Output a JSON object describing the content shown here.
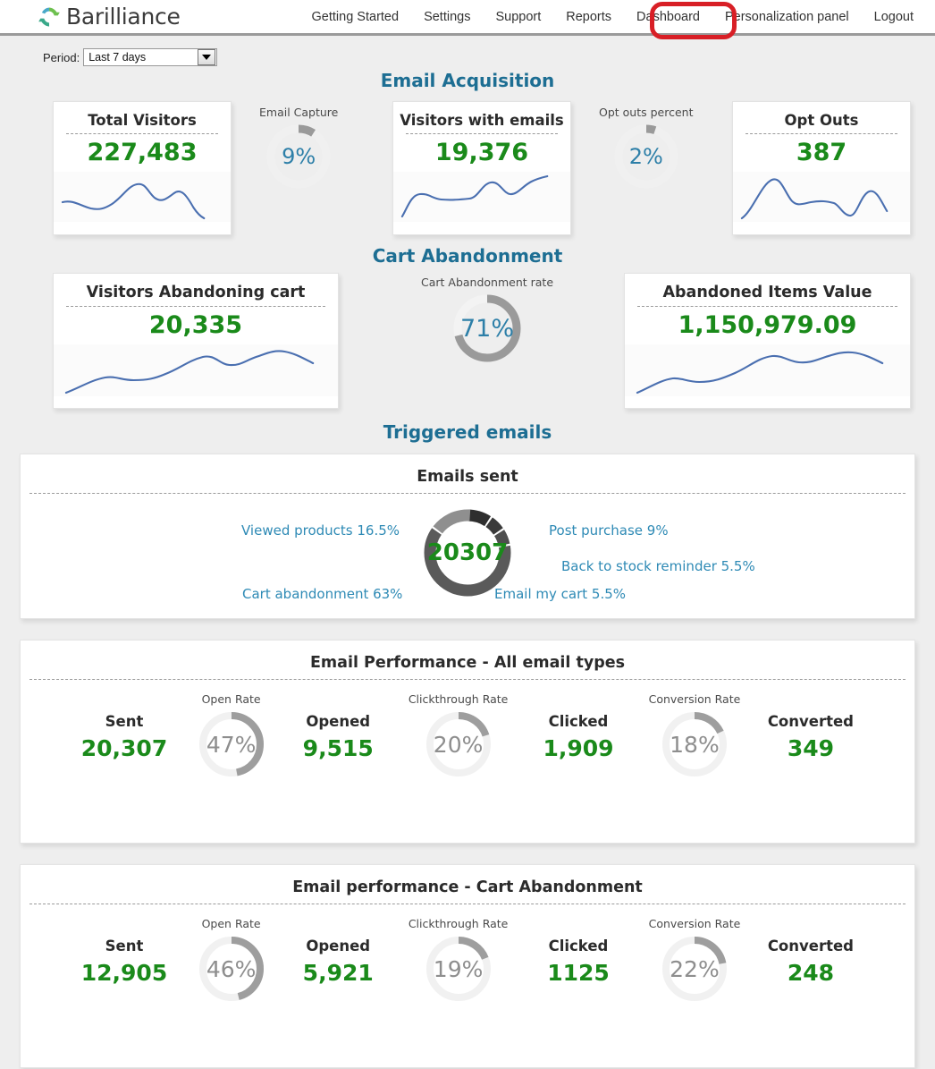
{
  "brand": {
    "name": "Barilliance",
    "logo_icon": "circular-arrow-logo"
  },
  "nav": {
    "items": [
      {
        "label": "Getting Started"
      },
      {
        "label": "Settings"
      },
      {
        "label": "Support"
      },
      {
        "label": "Reports"
      },
      {
        "label": "Dashboard",
        "highlighted": true
      },
      {
        "label": "Personalization panel"
      },
      {
        "label": "Logout"
      }
    ],
    "annotation_color": "#d81f26"
  },
  "filter": {
    "period_label": "Period:",
    "period_value": "Last 7 days",
    "dropdown_icon": "chevron-down-icon"
  },
  "colors": {
    "accent_blue": "#1d6e93",
    "value_green": "#1a8a1a",
    "gauge_track": "#ececec",
    "gauge_arc": "#9a9a9a",
    "sparkline": "#4a6fb0",
    "donut_label": "#2e8ab5"
  },
  "sections": {
    "email_acquisition": {
      "title": "Email Acquisition",
      "cards": [
        {
          "title": "Total Visitors",
          "value": "227,483"
        },
        {
          "title": "Visitors with emails",
          "value": "19,376"
        },
        {
          "title": "Opt Outs",
          "value": "387"
        }
      ],
      "gauges": [
        {
          "caption": "Email Capture",
          "value": "9%",
          "percent": 9
        },
        {
          "caption": "Opt outs percent",
          "value": "2%",
          "percent": 2
        }
      ]
    },
    "cart_abandonment": {
      "title": "Cart Abandonment",
      "cards": [
        {
          "title": "Visitors Abandoning cart",
          "value": "20,335"
        },
        {
          "title": "Abandoned Items Value",
          "value": "1,150,979.09"
        }
      ],
      "gauges": [
        {
          "caption": "Cart Abandonment rate",
          "value": "71%",
          "percent": 71
        }
      ]
    },
    "triggered_emails": {
      "title": "Triggered emails",
      "panel_title": "Emails sent",
      "total": "20307",
      "breakdown": [
        {
          "label": "Viewed products 16.5%",
          "percent": 16.5
        },
        {
          "label": "Post purchase 9%",
          "percent": 9
        },
        {
          "label": "Back to stock reminder 5.5%",
          "percent": 5.5
        },
        {
          "label": "Cart abandonment 63%",
          "percent": 63
        },
        {
          "label": "Email my cart 5.5%",
          "percent": 5.5
        }
      ]
    },
    "performance_all": {
      "title": "Email Performance - All email types",
      "stats": [
        {
          "label": "Sent",
          "value": "20,307"
        },
        {
          "label": "Opened",
          "value": "9,515"
        },
        {
          "label": "Clicked",
          "value": "1,909"
        },
        {
          "label": "Converted",
          "value": "349"
        }
      ],
      "gauges": [
        {
          "caption": "Open Rate",
          "value": "47%",
          "percent": 47
        },
        {
          "caption": "Clickthrough Rate",
          "value": "20%",
          "percent": 20
        },
        {
          "caption": "Conversion Rate",
          "value": "18%",
          "percent": 18
        }
      ]
    },
    "performance_cart": {
      "title": "Email performance - Cart Abandonment",
      "stats": [
        {
          "label": "Sent",
          "value": "12,905"
        },
        {
          "label": "Opened",
          "value": "5,921"
        },
        {
          "label": "Clicked",
          "value": "1125"
        },
        {
          "label": "Converted",
          "value": "248"
        }
      ],
      "gauges": [
        {
          "caption": "Open Rate",
          "value": "46%",
          "percent": 46
        },
        {
          "caption": "Clickthrough Rate",
          "value": "19%",
          "percent": 19
        },
        {
          "caption": "Conversion Rate",
          "value": "22%",
          "percent": 22
        }
      ]
    }
  },
  "chart_data": [
    {
      "type": "line",
      "title": "Total Visitors",
      "name": "total-visitors-sparkline",
      "y": [
        40,
        45,
        58,
        56,
        30,
        34,
        55,
        72,
        66,
        42,
        55,
        30,
        8
      ]
    },
    {
      "type": "line",
      "title": "Visitors with emails",
      "name": "visitors-with-emails-sparkline",
      "y": [
        6,
        38,
        45,
        42,
        41,
        42,
        46,
        72,
        58,
        50,
        66,
        76,
        78
      ]
    },
    {
      "type": "line",
      "title": "Opt Outs",
      "name": "opt-outs-sparkline",
      "y": [
        4,
        30,
        58,
        82,
        62,
        42,
        45,
        46,
        40,
        20,
        42,
        62,
        38
      ]
    },
    {
      "type": "line",
      "title": "Visitors Abandoning cart",
      "name": "visitors-abandoning-cart-sparkline",
      "y": [
        8,
        26,
        38,
        37,
        36,
        40,
        50,
        60,
        66,
        58,
        58,
        70,
        72,
        62
      ]
    },
    {
      "type": "line",
      "title": "Abandoned Items Value",
      "name": "abandoned-items-value-sparkline",
      "y": [
        6,
        28,
        40,
        36,
        36,
        44,
        56,
        66,
        64,
        62,
        72,
        74,
        64,
        58
      ]
    },
    {
      "type": "pie",
      "title": "Emails sent",
      "name": "triggered-emails-donut",
      "center_value": "20307",
      "labels": [
        "Cart abandonment",
        "Viewed products",
        "Post purchase",
        "Back to stock reminder",
        "Email my cart"
      ],
      "values": [
        63,
        16.5,
        9,
        5.5,
        5.5
      ]
    }
  ]
}
